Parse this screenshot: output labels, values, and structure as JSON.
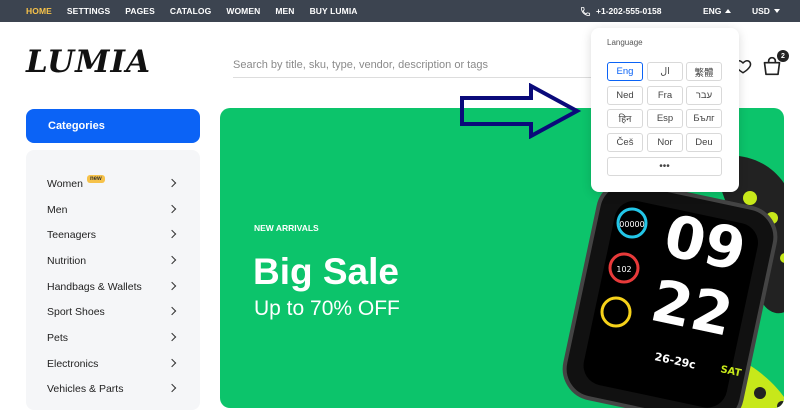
{
  "topbar": {
    "nav": [
      "HOME",
      "SETTINGS",
      "PAGES",
      "CATALOG",
      "WOMEN",
      "MEN",
      "BUY LUMIA"
    ],
    "active": "HOME",
    "phone": "+1-202-555-0158",
    "language_selected": "ENG",
    "currency_selected": "USD",
    "colors": {
      "background": "#3c4450",
      "active": "#f6c24a"
    }
  },
  "header": {
    "logo": "LUMIA",
    "search_placeholder": "Search by title, sku, type, vendor, description or tags",
    "cart_count": "2",
    "icons": [
      "heart-icon",
      "shopping-bag-icon"
    ]
  },
  "sidebar": {
    "title": "Categories",
    "items": [
      {
        "label": "Women",
        "badge": "new"
      },
      {
        "label": "Men"
      },
      {
        "label": "Teenagers"
      },
      {
        "label": "Nutrition"
      },
      {
        "label": "Handbags & Wallets"
      },
      {
        "label": "Sport Shoes"
      },
      {
        "label": "Pets"
      },
      {
        "label": "Electronics"
      },
      {
        "label": "Vehicles & Parts"
      }
    ],
    "accent": "#0b63f6"
  },
  "banner": {
    "eyebrow": "NEW ARRIVALS",
    "headline": "Big Sale",
    "subline": "Up to 70% OFF",
    "background": "#0cc46b",
    "watch": {
      "hour": "09",
      "minute": "22",
      "temp": "26-29c",
      "status": "SAT",
      "heart": "102",
      "steps": "00000"
    }
  },
  "language_menu": {
    "title": "Language",
    "options": [
      "Eng",
      "ال",
      "繁體",
      "Ned",
      "Fra",
      "עבר",
      "हिन",
      "Esp",
      "Бълг",
      "Češ",
      "Nor",
      "Deu"
    ],
    "selected": "Eng",
    "more": "•••"
  },
  "annotation": {
    "arrow_color": "#0a0a7a",
    "direction": "right"
  }
}
